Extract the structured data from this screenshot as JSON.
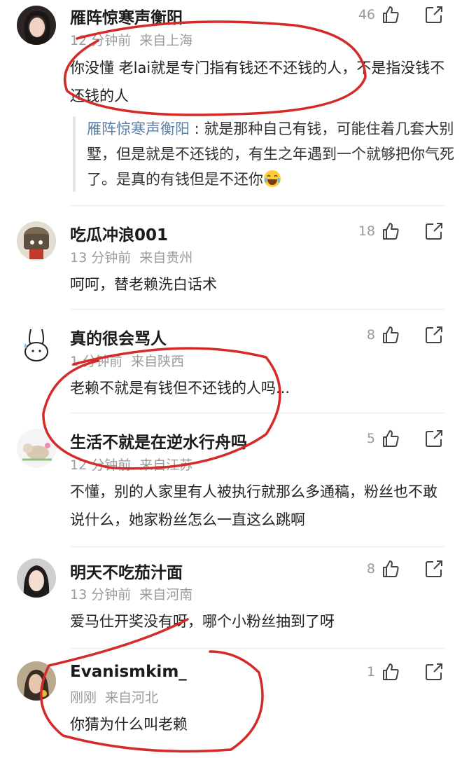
{
  "comments": [
    {
      "username": "雁阵惊寒声衡阳",
      "time": "12 分钟前",
      "location": "来自上海",
      "text": "你没懂 老lai就是专门指有钱还不还钱的人，不是指没钱不还钱的人",
      "likes": "46",
      "reply": {
        "author": "雁阵惊寒声衡阳",
        "separator": " : ",
        "text": "就是那种自己有钱，可能住着几套大别墅，但是就是不还钱的，有生之年遇到一个就够把你气死了。是真的有钱但是不还你",
        "emoji": "laughing-crying-emoji"
      }
    },
    {
      "username": "吃瓜冲浪001",
      "time": "13 分钟前",
      "location": "来自贵州",
      "text": "呵呵，替老赖洗白话术",
      "likes": "18"
    },
    {
      "username": "真的很会骂人",
      "time": "1 分钟前",
      "location": "来自陕西",
      "text": "老赖不就是有钱但不还钱的人吗...",
      "likes": "8"
    },
    {
      "username": "生活不就是在逆水行舟吗",
      "time": "12 分钟前",
      "location": "来自江苏",
      "text": "不懂，别的人家里有人被执行就那么多通稿，粉丝也不敢说什么，她家粉丝怎么一直这么跳啊",
      "likes": "5"
    },
    {
      "username": "明天不吃茄汁面",
      "time": "13 分钟前",
      "location": "来自河南",
      "text": "爱马仕开奖没有呀，哪个小粉丝抽到了呀",
      "likes": "8"
    },
    {
      "username": "Evanismkim_",
      "time": "刚刚",
      "location": "来自河北",
      "text": "你猜为什么叫老赖",
      "likes": "1"
    }
  ],
  "icons": {
    "like": "thumbs-up-icon",
    "share": "share-icon"
  },
  "colors": {
    "annotation": "#d42a2a",
    "meta": "#9b9b9b",
    "reply_author": "#5b7fa6"
  }
}
